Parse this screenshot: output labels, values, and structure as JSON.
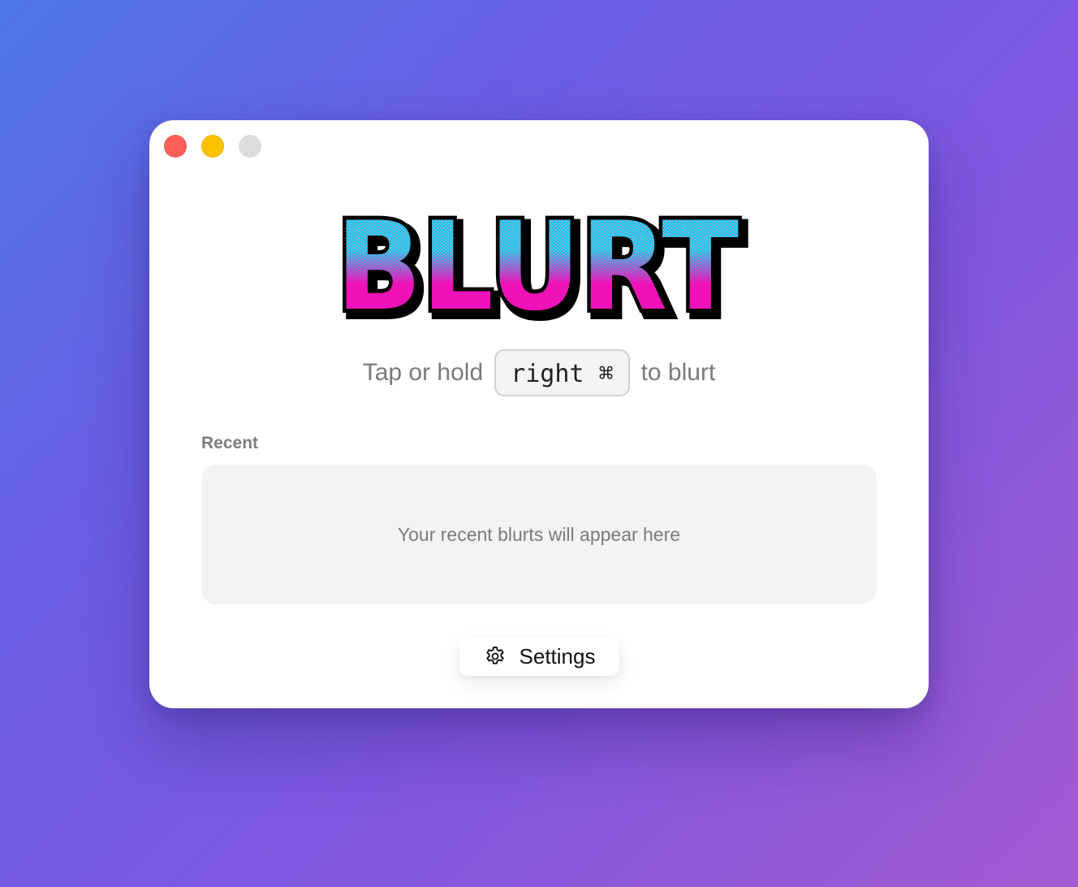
{
  "window": {
    "controls": {
      "close": "close-window",
      "minimize": "minimize-window",
      "zoom": "zoom-window"
    }
  },
  "logo": {
    "text": "BLURT",
    "colors": {
      "top": "#19e6ef",
      "bottom": "#ee12b8",
      "outline": "#000000"
    }
  },
  "instruction": {
    "before": "Tap or hold",
    "key": "right ⌘",
    "after": "to blurt"
  },
  "recent": {
    "label": "Recent",
    "empty_message": "Your recent blurts will appear here"
  },
  "settings": {
    "label": "Settings",
    "icon": "gear-icon"
  }
}
